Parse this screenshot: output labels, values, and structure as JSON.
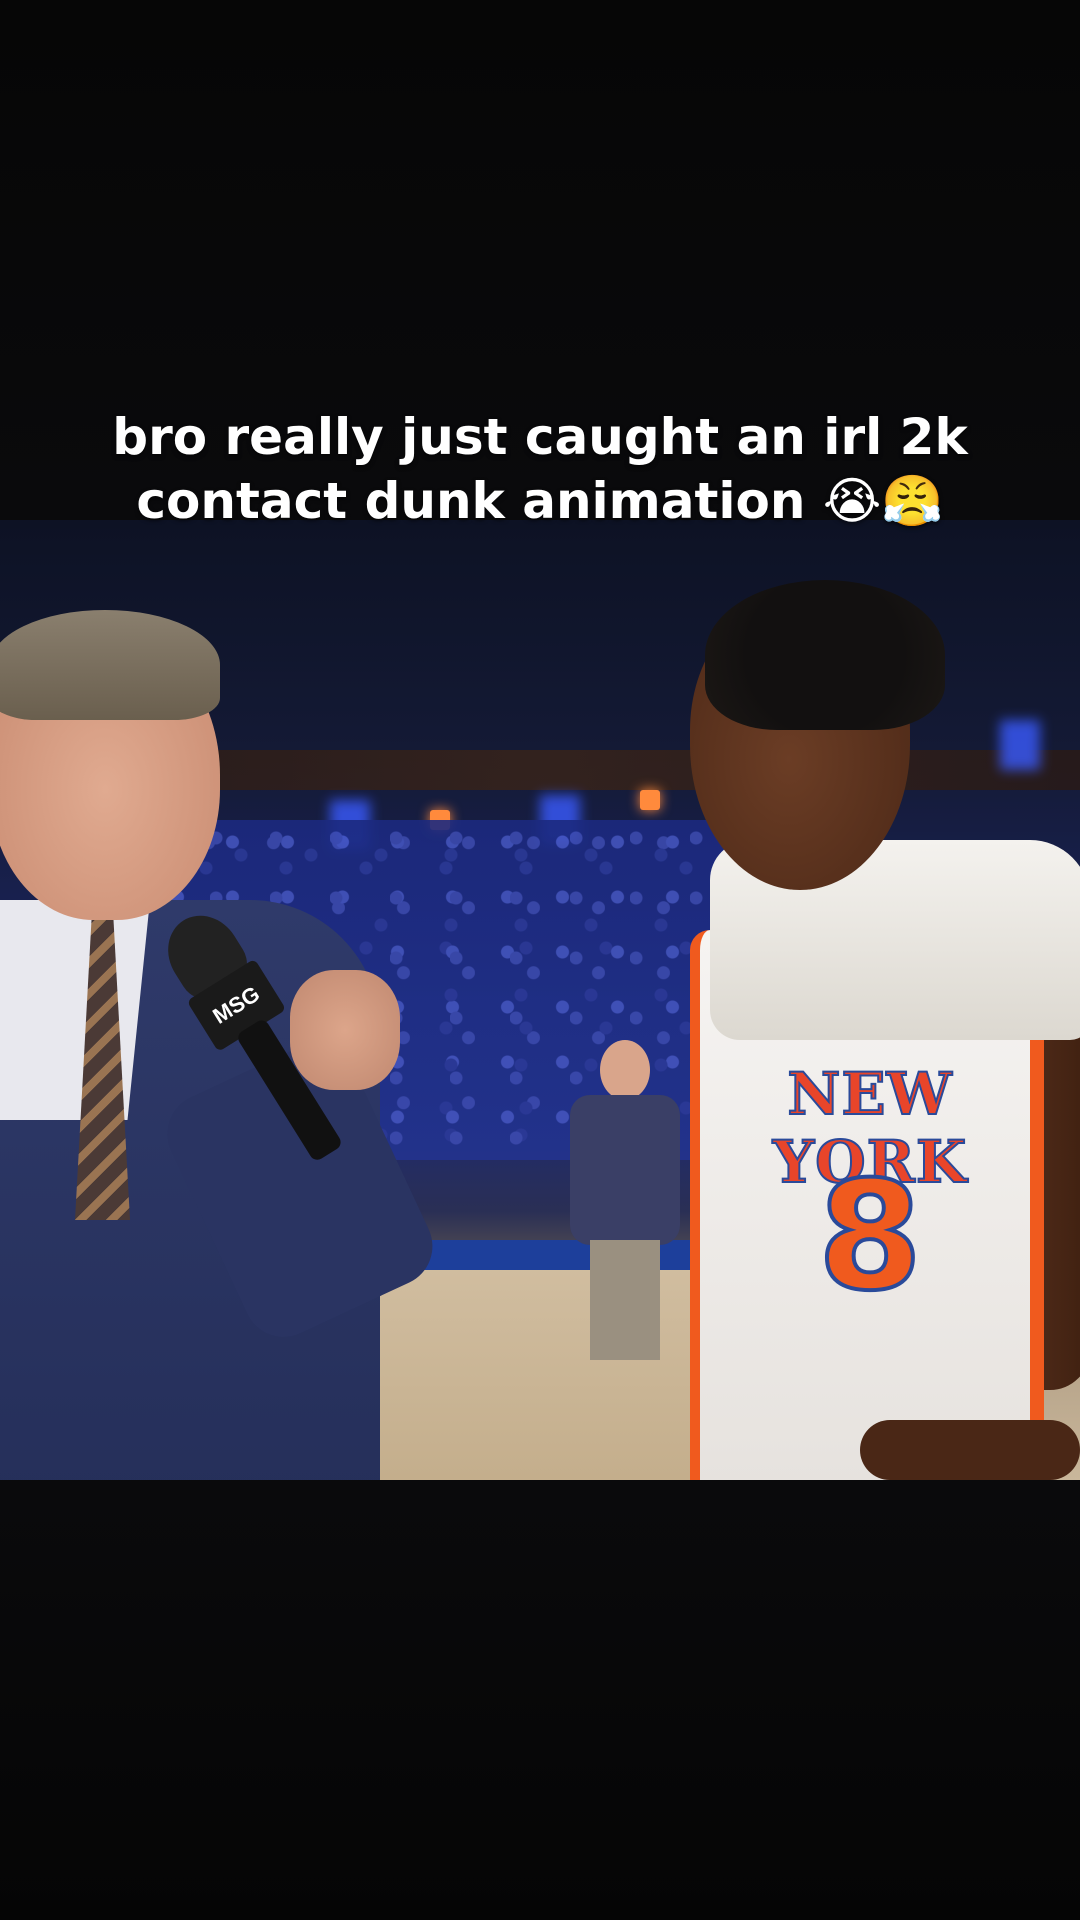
{
  "caption": {
    "line1": "bro really just caught an irl 2k",
    "line2": "contact dunk animation 😭😤"
  },
  "video": {
    "mic_flag_text": "MSG",
    "jersey_text": "NEW YORK",
    "jersey_number": "8"
  },
  "colors": {
    "background": "#050505",
    "caption_text": "#ffffff",
    "jersey_orange": "#f05a1e",
    "jersey_blue": "#2a4a9a"
  }
}
